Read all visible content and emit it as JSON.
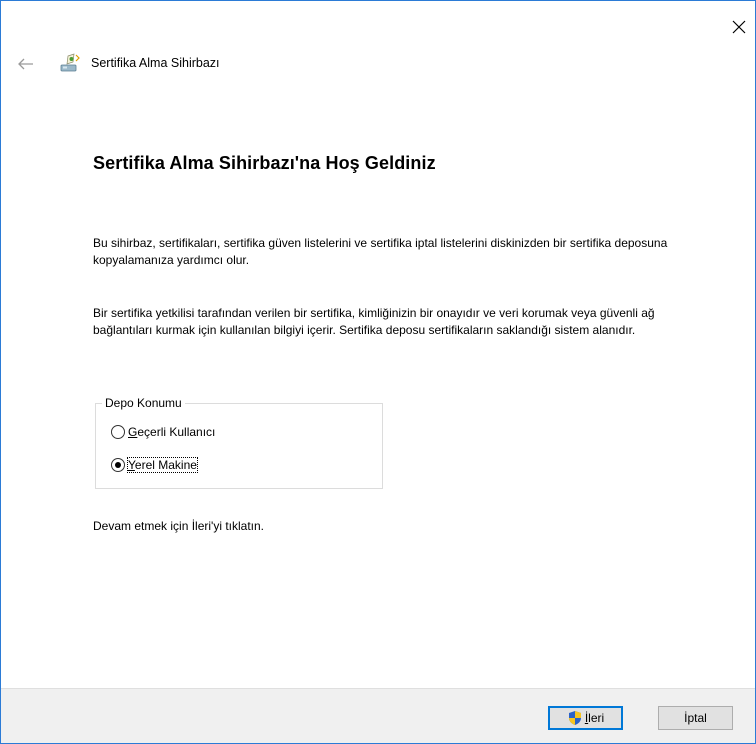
{
  "window": {
    "title": "Sertifika Alma Sihirbazı",
    "close_glyph": "✕",
    "back_glyph": "←"
  },
  "main": {
    "heading": "Sertifika Alma Sihirbazı'na Hoş Geldiniz",
    "paragraph1": "Bu sihirbaz, sertifikaları, sertifika güven listelerini ve sertifika iptal listelerini diskinizden bir sertifika deposuna kopyalamanıza yardımcı olur.",
    "paragraph2": "Bir sertifika yetkilisi tarafından verilen bir sertifika, kimliğinizin bir onayıdır ve veri korumak veya güvenli ağ bağlantıları kurmak için kullanılan bilgiyi içerir. Sertifika deposu sertifikaların saklandığı sistem alanıdır.",
    "store_location": {
      "legend": "Depo Konumu",
      "options": [
        {
          "accel": "G",
          "rest": "eçerli Kullanıcı",
          "checked": false
        },
        {
          "accel": "Y",
          "rest": "erel Makine",
          "checked": true
        }
      ]
    },
    "footer": "Devam etmek için İleri'yi tıklatın."
  },
  "buttons": {
    "next": {
      "accel": "İ",
      "rest": "leri",
      "icon": "uac-shield-icon"
    },
    "cancel": {
      "label": "İptal"
    }
  },
  "colors": {
    "accent": "#0078d7",
    "window_border": "#2b7bd6",
    "footer_bg": "#f0f0f0"
  }
}
